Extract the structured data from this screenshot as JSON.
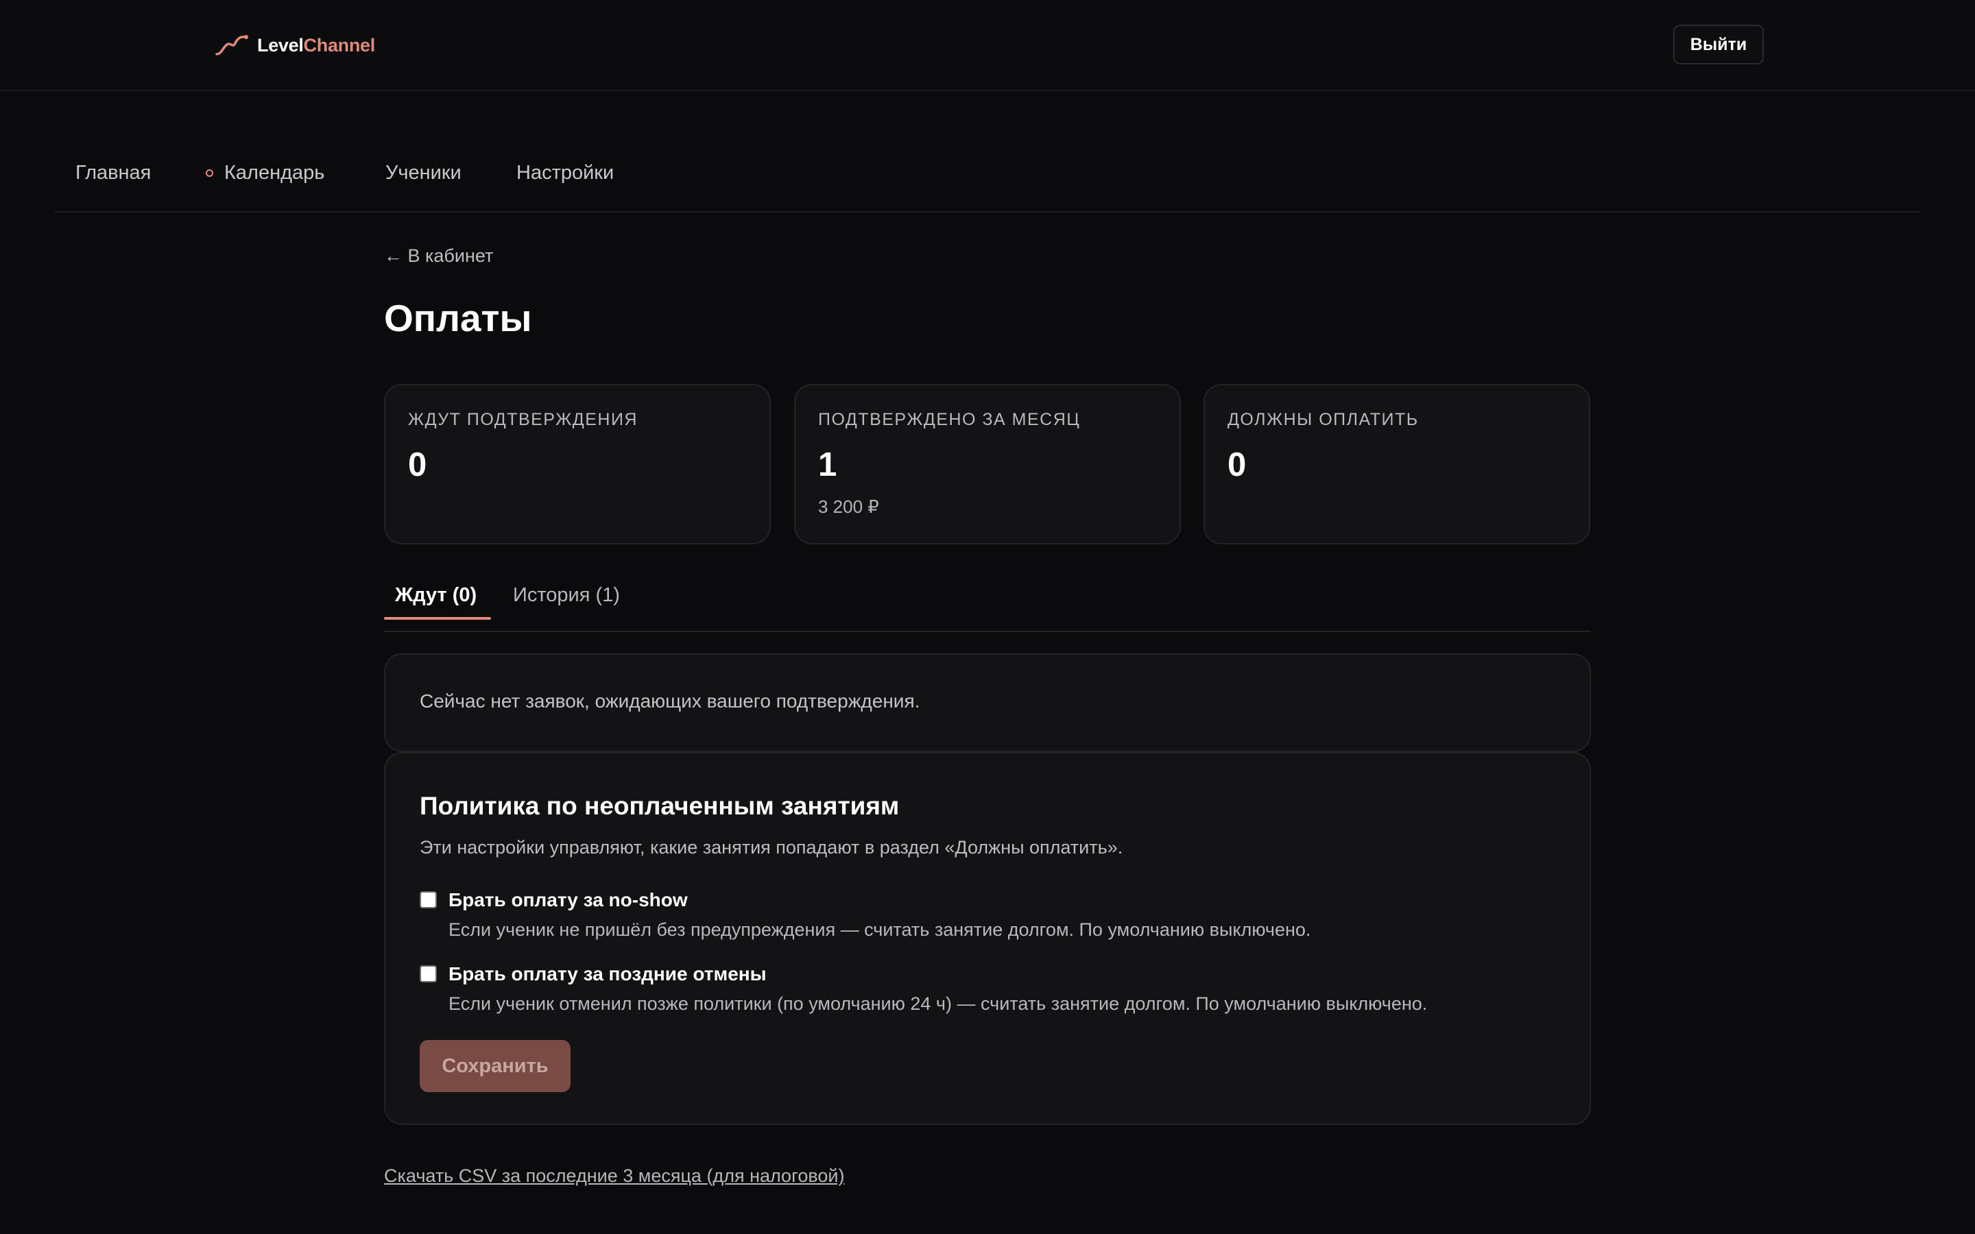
{
  "header": {
    "logo": {
      "part1": "Level",
      "part2": "Channel",
      "icon": "wave-logo-icon"
    },
    "logout_label": "Выйти"
  },
  "nav": {
    "items": [
      {
        "label": "Главная"
      },
      {
        "label": "Календарь",
        "icon": "dot-icon"
      },
      {
        "label": "Ученики"
      },
      {
        "label": "Настройки"
      }
    ]
  },
  "page": {
    "back_label": "← В кабинет",
    "title": "Оплаты"
  },
  "stats": [
    {
      "label": "ЖДУТ ПОДТВЕРЖДЕНИЯ",
      "value": "0",
      "sub": ""
    },
    {
      "label": "ПОДТВЕРЖДЕНО ЗА МЕСЯЦ",
      "value": "1",
      "sub": "3 200 ₽"
    },
    {
      "label": "ДОЛЖНЫ ОПЛАТИТЬ",
      "value": "0",
      "sub": ""
    }
  ],
  "tabs": [
    {
      "label": "Ждут (0)",
      "active": true
    },
    {
      "label": "История (1)",
      "active": false
    }
  ],
  "empty_state": {
    "text": "Сейчас нет заявок, ожидающих вашего подтверждения."
  },
  "policy": {
    "title": "Политика по неоплаченным занятиям",
    "description": "Эти настройки управляют, какие занятия попадают в раздел «Должны оплатить».",
    "options": [
      {
        "label": "Брать оплату за no-show",
        "help": "Если ученик не пришёл без предупреждения — считать занятие долгом. По умолчанию выключено.",
        "checked": false
      },
      {
        "label": "Брать оплату за поздние отмены",
        "help": "Если ученик отменил позже политики (по умолчанию 24 ч) — считать занятие долгом. По умолчанию выключено.",
        "checked": false
      }
    ],
    "save_label": "Сохранить"
  },
  "footer": {
    "csv_link": "Скачать CSV за последние 3 месяца (для налоговой)"
  },
  "colors": {
    "background": "#0b0b0d",
    "card": "#131316",
    "accent": "#e08a7a",
    "save_button": "#7a4a45"
  }
}
